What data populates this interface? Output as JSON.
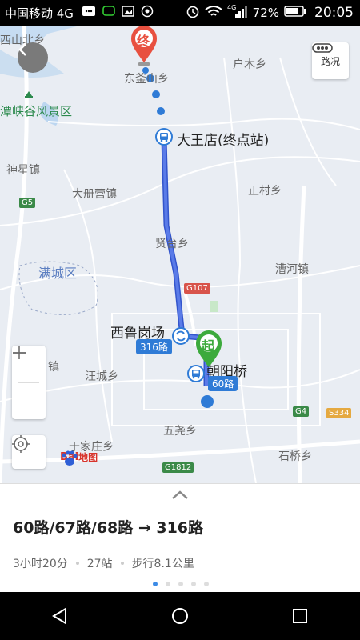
{
  "status_bar": {
    "carrier": "中国移动 4G",
    "network": "4G",
    "battery": "72%",
    "time": "20:05"
  },
  "map": {
    "traffic_label": "路况",
    "end_marker": "终",
    "start_marker": "起",
    "stops": {
      "terminus": "大王店(终点站)",
      "transfer": "西鲁岗场",
      "start": "朝阳桥"
    },
    "route_badges": {
      "transfer_line": "316路",
      "start_line": "60路"
    },
    "places": [
      "西山北乡",
      "东釜山乡",
      "户木乡",
      "潭峡谷风景区",
      "神星镇",
      "大册营镇",
      "正村乡",
      "贤台乡",
      "满城区",
      "漕河镇",
      "汪城乡",
      "镇",
      "五尧乡",
      "于家庄乡",
      "石桥乡"
    ],
    "road_shields": [
      "G5",
      "G107",
      "G4",
      "S334",
      "G1812"
    ],
    "logo": "地图",
    "logo_brand": "Bai"
  },
  "sheet": {
    "route": "60路/67路/68路 → 316路",
    "duration": "3小时20分",
    "stations": "27站",
    "walk": "步行8.1公里",
    "pages": 5,
    "active_page": 1
  },
  "colors": {
    "route_line": "#4466dd",
    "start_marker": "#3caa3c",
    "end_marker": "#e8503f",
    "accent": "#3d8be6"
  }
}
